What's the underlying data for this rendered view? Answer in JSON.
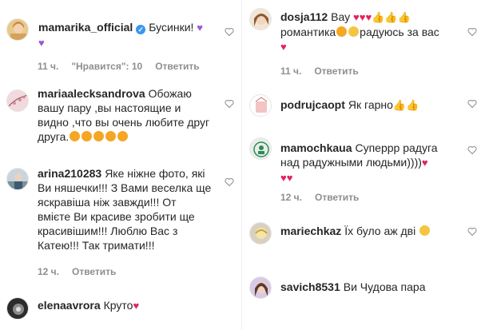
{
  "left": [
    {
      "user": "mamarika_official",
      "verified": true,
      "text": "Бусинки!",
      "emojis": [
        "purple-heart",
        "purple-heart"
      ],
      "time": "11 ч.",
      "likes": "\"Нравится\": 10",
      "reply": "Ответить"
    },
    {
      "user": "mariaalecksandrova",
      "text": "Обожаю вашу пару ,вы настоящие и видно ,что вы очень любите друг друга.",
      "emojis": [
        "star-eyes",
        "star-eyes",
        "star-eyes",
        "star-eyes",
        "star-eyes"
      ]
    },
    {
      "user": "arina210283",
      "text": "Яке ніжне фото, які Ви няшечки!!! З Вами веселка ще яскравіша ніж завжди!!! От вмієте Ви красиве зробити ще красивішим!!! Люблю Вас з Катею!!! Так тримати!!!",
      "time": "12 ч.",
      "reply": "Ответить"
    },
    {
      "user": "elenaavrora",
      "text": "Круто",
      "emojis": [
        "red-heart"
      ]
    }
  ],
  "right": [
    {
      "user": "dosja112",
      "text": "Вау",
      "text2": "романтика",
      "text3": "радуюсь за вас",
      "time": "11 ч.",
      "reply": "Ответить"
    },
    {
      "user": "podrujcaopt",
      "text": "Як гарно",
      "emojis": [
        "thumbs-up",
        "thumbs-up"
      ]
    },
    {
      "user": "mamochkaua",
      "text": "Суперрр радуга над радужными людьми))))",
      "time": "12 ч.",
      "reply": "Ответить"
    },
    {
      "user": "mariechkaz",
      "text": "Їх було аж дві",
      "emojis": [
        "smile"
      ]
    },
    {
      "user": "savich8531",
      "text": "Ви Чудова пара"
    }
  ],
  "colors": {
    "heart": "#e0245e",
    "purple_heart": "#9b59d0",
    "verified": "#3897f0",
    "meta": "#8e8e8e"
  }
}
